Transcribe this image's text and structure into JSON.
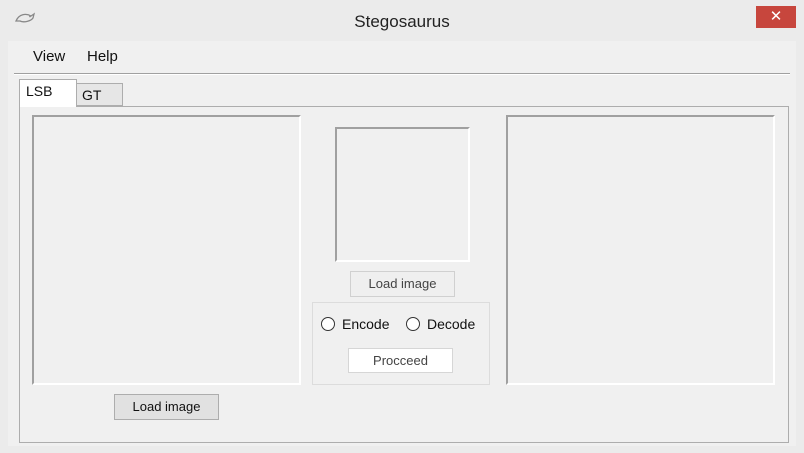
{
  "window": {
    "title": "Stegosaurus",
    "close_glyph": "✕"
  },
  "menu": {
    "items": [
      {
        "label": "View"
      },
      {
        "label": "Help"
      }
    ]
  },
  "tabs": [
    {
      "label": "LSB",
      "selected": true
    },
    {
      "label": "GT",
      "selected": false
    }
  ],
  "lsb": {
    "load_image_left_label": "Load image",
    "load_image_center_label": "Load image",
    "mode_options": [
      {
        "label": "Encode",
        "checked": false
      },
      {
        "label": "Decode",
        "checked": false
      }
    ],
    "proceed_label": "Procceed"
  },
  "icons": {
    "app": "stegosaurus-app-icon",
    "close": "close-icon",
    "accent_close": "#c7463d"
  }
}
